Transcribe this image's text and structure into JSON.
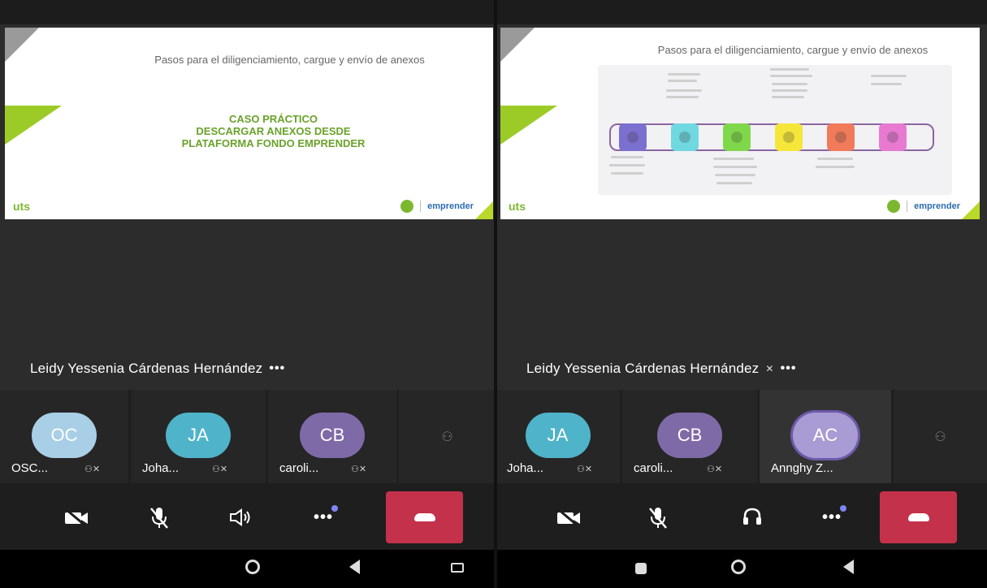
{
  "left": {
    "slide": {
      "title": "Pasos para el diligenciamiento, cargue y envío de anexos",
      "case_lines": [
        "CASO PRÁCTICO",
        "DESCARGAR ANEXOS DESDE",
        "PLATAFORMA FONDO EMPRENDER"
      ],
      "uts_logo": "uts",
      "brand_text": "emprender"
    },
    "speaker": "Leidy Yessenia Cárdenas Hernández",
    "more": "•••",
    "tiles": [
      {
        "initials": "OC",
        "name": "OSC...",
        "color": "#a9cfe6"
      },
      {
        "initials": "JA",
        "name": "Joha...",
        "color": "#4fb3c9"
      },
      {
        "initials": "CB",
        "name": "caroli...",
        "color": "#7f6aa8"
      }
    ]
  },
  "right": {
    "slide": {
      "title": "Pasos para el diligenciamiento, cargue y envío de anexos",
      "uts_logo": "uts",
      "brand_text": "emprender",
      "step_colors": [
        "#7b6fd0",
        "#6fd8e0",
        "#7fd84a",
        "#f6e63a",
        "#f07a5a",
        "#e77ad0"
      ]
    },
    "speaker": "Leidy Yessenia Cárdenas Hernández",
    "more": "•••",
    "tiles": [
      {
        "initials": "JA",
        "name": "Joha...",
        "color": "#4fb3c9"
      },
      {
        "initials": "CB",
        "name": "caroli...",
        "color": "#7f6aa8"
      },
      {
        "initials": "AC",
        "name": "Annghy Z...",
        "color": "#a99bd3"
      }
    ]
  },
  "icons": {
    "camera_off": "camera-off-icon",
    "mic_off": "mic-off-icon",
    "speaker": "speaker-icon",
    "headset": "headset-icon",
    "more": "more-actions-icon",
    "hangup": "hangup-icon"
  },
  "colors": {
    "hangup": "#c4314b",
    "accent_green": "#9ccb28",
    "badge": "#7f85f5"
  }
}
